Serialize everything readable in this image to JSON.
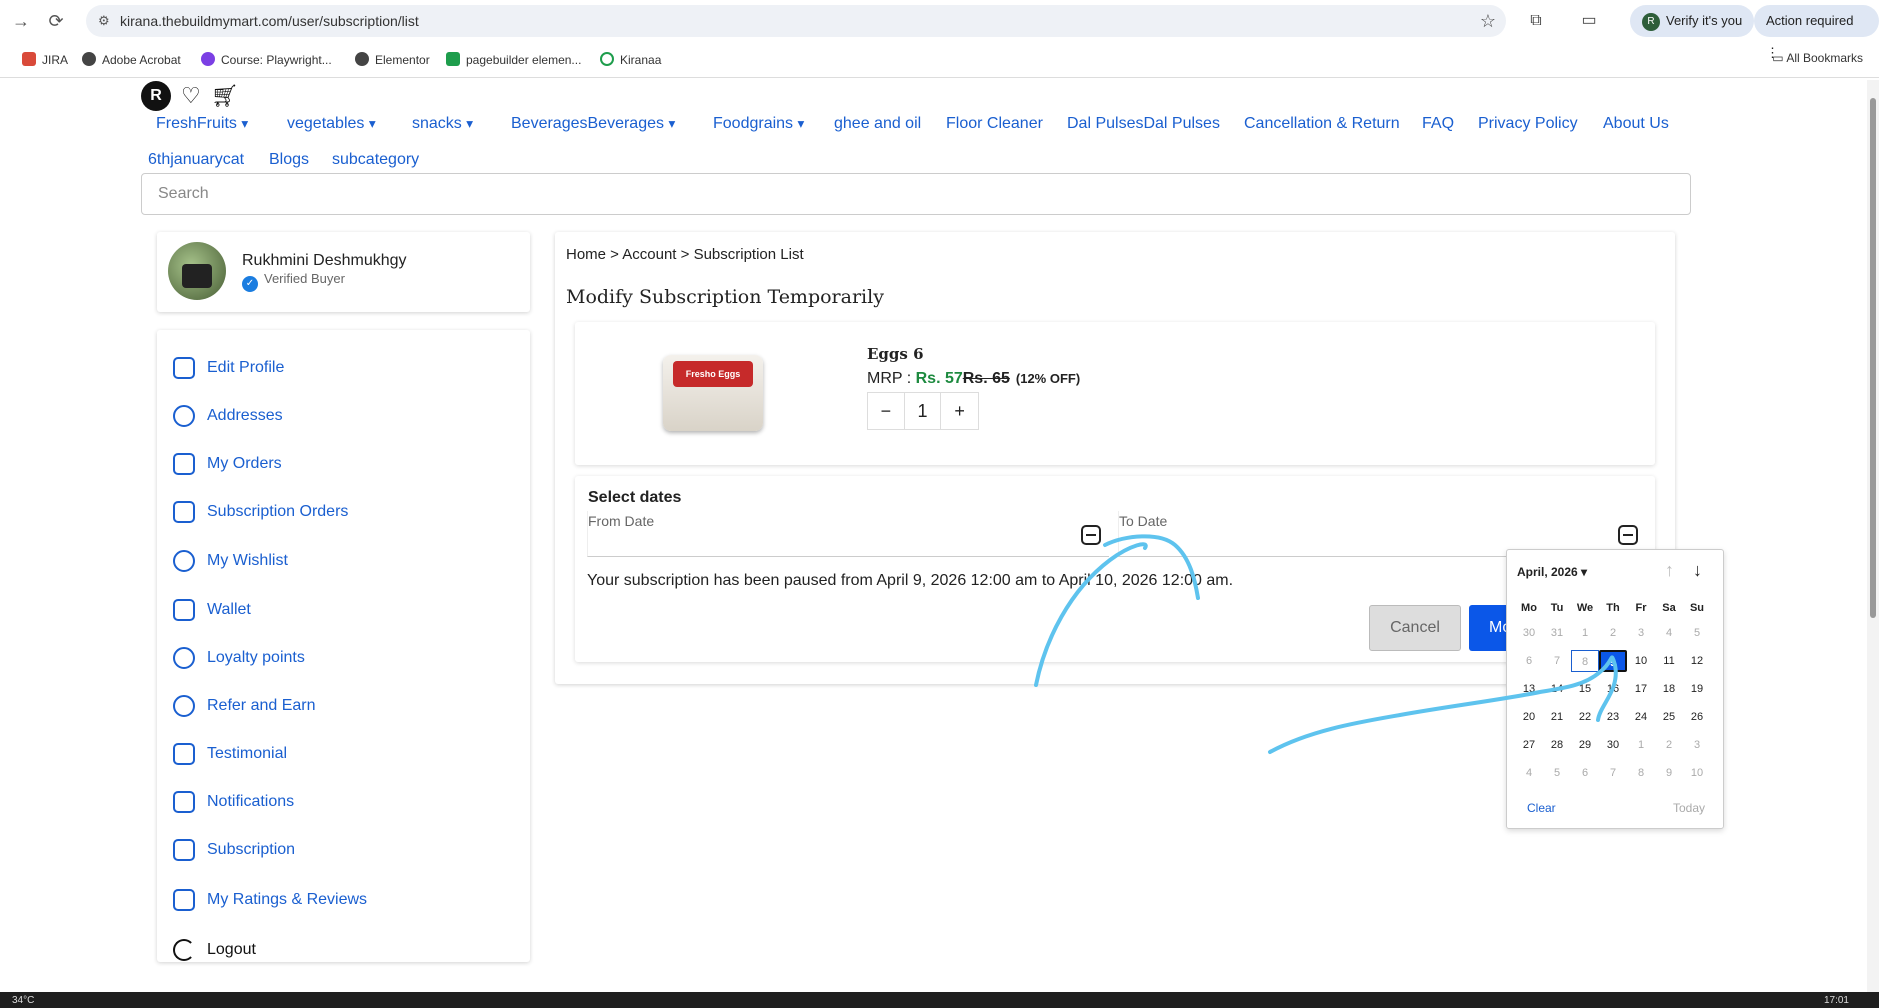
{
  "browser": {
    "url": "kirana.thebuildmymart.com/user/subscription/list",
    "verify_label": "Verify it's you",
    "verify_avatar": "R",
    "action_label": "Action required",
    "bookmarks": [
      "JIRA",
      "Adobe Acrobat",
      "Course: Playwright...",
      "Elementor",
      "pagebuilder elemen...",
      "Kiranaa"
    ],
    "all_bookmarks": "All Bookmarks"
  },
  "header": {
    "logo_letter": "R",
    "nav": [
      "FreshFruits",
      "vegetables",
      "snacks",
      "BeveragesBeverages",
      "Foodgrains",
      "ghee and oil",
      "Floor Cleaner",
      "Dal PulsesDal Pulses",
      "Cancellation & Return",
      "FAQ",
      "Privacy Policy",
      "About Us",
      "6thjanuarycat",
      "Blogs",
      "subcategory"
    ],
    "dropdown_marker": "▾",
    "search_placeholder": "Search"
  },
  "profile": {
    "name": "Rukhmini Deshmukhgy",
    "badge": "Verified Buyer"
  },
  "menu": [
    "Edit Profile",
    "Addresses",
    "My Orders",
    "Subscription Orders",
    "My Wishlist",
    "Wallet",
    "Loyalty points",
    "Refer and Earn",
    "Testimonial",
    "Notifications",
    "Subscription",
    "My Ratings & Reviews",
    "Logout"
  ],
  "breadcrumb": "Home > Account > Subscription List",
  "page_title": "Modify Subscription Temporarily",
  "product": {
    "name": "Eggs 6",
    "mrp_label": "MRP :",
    "price": "Rs. 57",
    "strike": "Rs. 65",
    "off": "(12% OFF)",
    "qty": "1",
    "minus": "−",
    "plus": "+",
    "image_label": "Fresho Eggs"
  },
  "dates": {
    "title": "Select dates",
    "from_label": "From Date",
    "to_label": "To Date",
    "message": "Your subscription has been paused from April 9, 2026 12:00 am to April 10, 2026 12:00 am.",
    "cancel": "Cancel",
    "modify": "Modify"
  },
  "datepicker": {
    "month": "April, 2026 ▾",
    "weekdays": [
      "Mo",
      "Tu",
      "We",
      "Th",
      "Fr",
      "Sa",
      "Su"
    ],
    "weeks": [
      [
        "30",
        "31",
        "1",
        "2",
        "3",
        "4",
        "5"
      ],
      [
        "6",
        "7",
        "8",
        "9",
        "10",
        "11",
        "12"
      ],
      [
        "13",
        "14",
        "15",
        "16",
        "17",
        "18",
        "19"
      ],
      [
        "20",
        "21",
        "22",
        "23",
        "24",
        "25",
        "26"
      ],
      [
        "27",
        "28",
        "29",
        "30",
        "1",
        "2",
        "3"
      ],
      [
        "4",
        "5",
        "6",
        "7",
        "8",
        "9",
        "10"
      ]
    ],
    "selected": "9",
    "clear": "Clear",
    "today": "Today"
  },
  "taskbar": {
    "temp": "34°C",
    "time": "17:01"
  },
  "colors": {
    "link": "#1a5fd0",
    "primary": "#0b57e8",
    "price_green": "#1d8a3f",
    "annotation": "#5ec3ee"
  }
}
